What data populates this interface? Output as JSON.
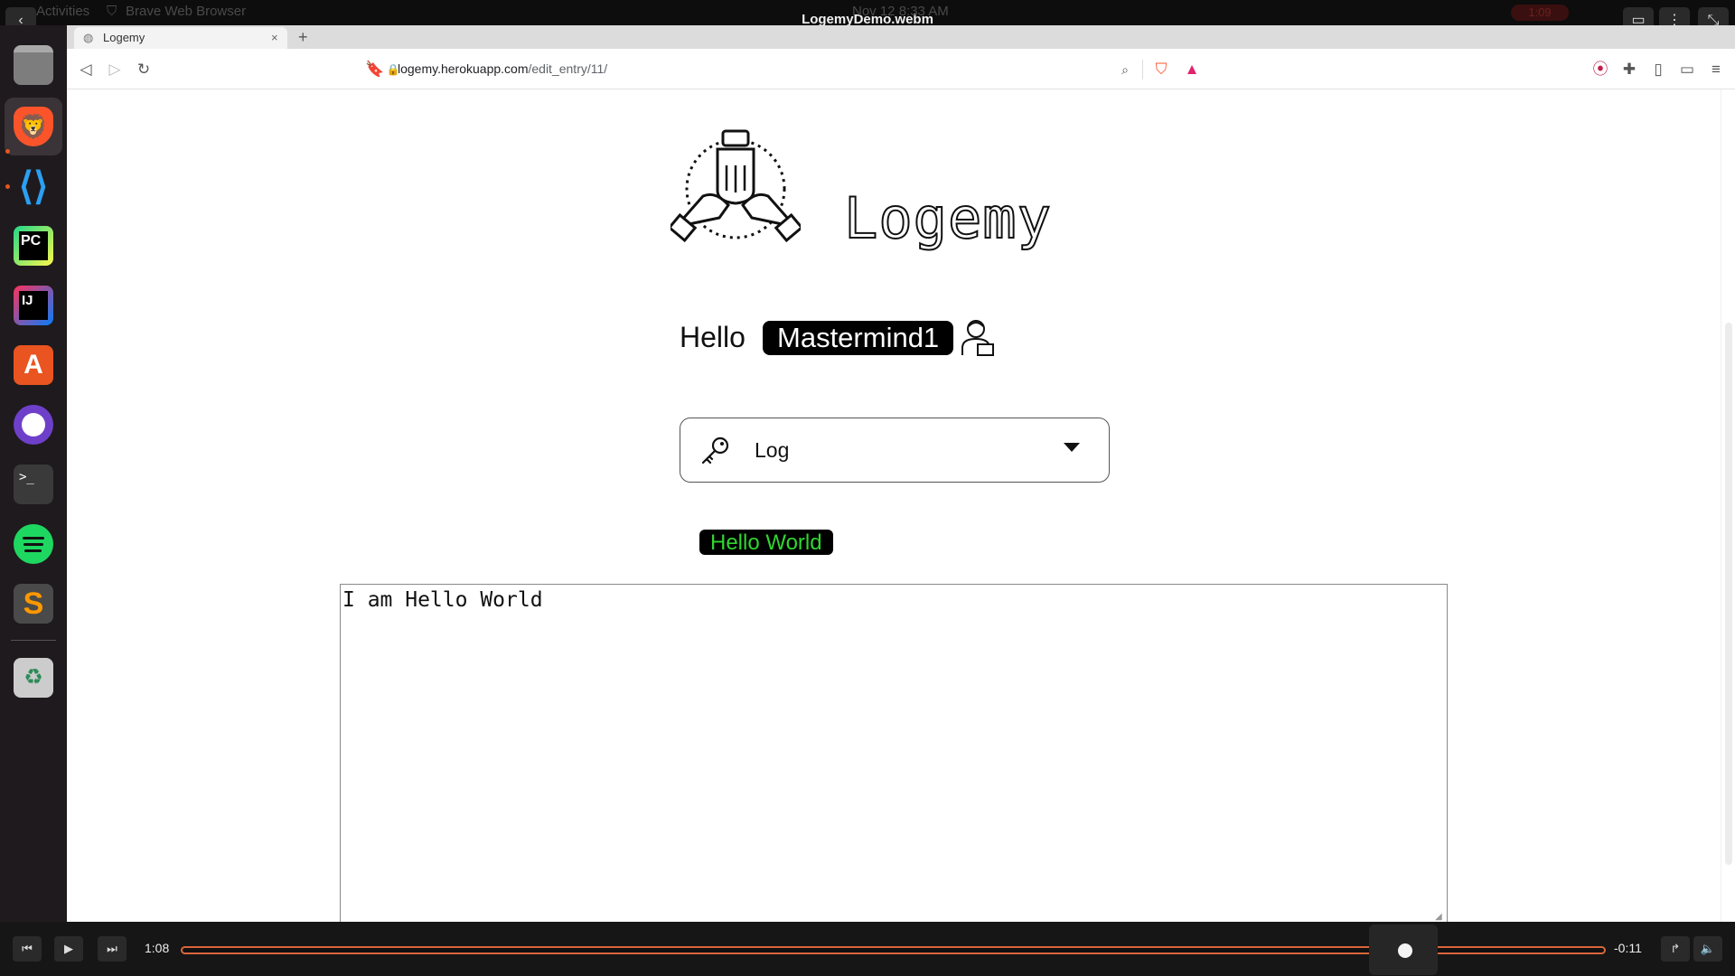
{
  "player": {
    "title": "LogemyDemo.webm",
    "ghost_activities": "Activities",
    "ghost_app": "Brave Web Browser",
    "ghost_clock": "Nov 12  8:33 AM",
    "ghost_rec": "1:09"
  },
  "dock": {
    "items": [
      "files-icon",
      "brave-browser-icon",
      "vscode-icon",
      "pycharm-icon",
      "intellij-icon",
      "app-center-icon",
      "github-desktop-icon",
      "terminal-icon",
      "spotify-icon",
      "sublime-text-icon",
      "trash-icon"
    ],
    "accent": "#e95420"
  },
  "browser": {
    "tab_title": "Logemy",
    "url_host": "logemy.herokuapp.com",
    "url_path": "/edit_entry/11/"
  },
  "page": {
    "logo_text": "Logemy",
    "greeting": "Hello",
    "username": "Mastermind1",
    "select_value": "Log",
    "entry_title": "Hello World",
    "entry_body": "I am Hello World",
    "colors": {
      "entry_title": "#30d630",
      "pill_bg": "#000000"
    }
  },
  "controls": {
    "elapsed": "1:08",
    "remaining": "-0:11",
    "progress_fraction": 0.86,
    "accent": "#d9653a"
  }
}
